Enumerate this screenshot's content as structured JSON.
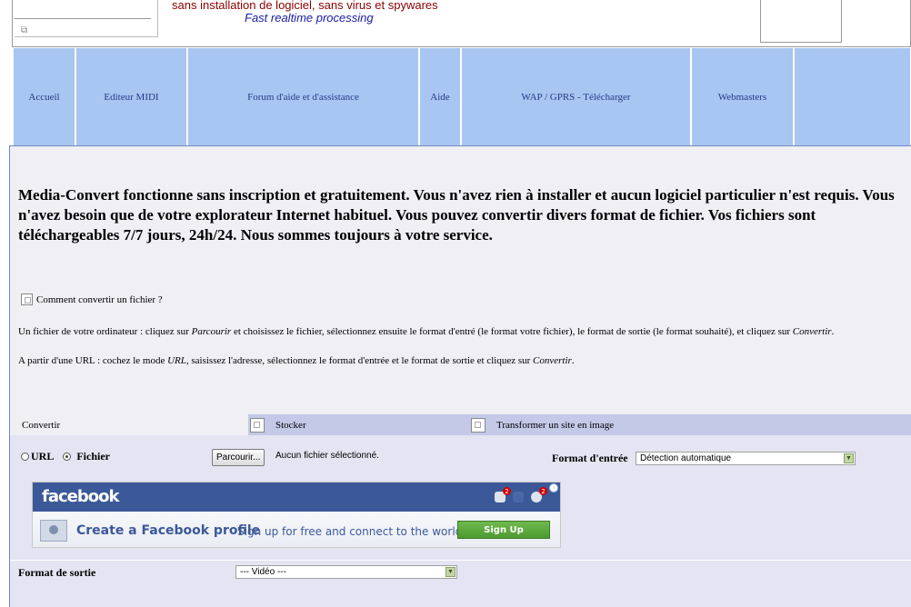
{
  "header": {
    "tagline_main": "sans installation de logiciel, sans virus et spywares",
    "tagline_sub": "Fast realtime processing",
    "left_icon": "broken-image-icon"
  },
  "nav": {
    "items": [
      {
        "label": "Accueil"
      },
      {
        "label": "Editeur MIDI"
      },
      {
        "label": "Forum d'aide et d'assistance"
      },
      {
        "label": "Aide"
      },
      {
        "label": "WAP / GPRS - Télécharger"
      },
      {
        "label": "Webmasters"
      },
      {
        "label": ""
      }
    ],
    "bg_color": "#a7c6f1",
    "text_color": "#263a88"
  },
  "intro": {
    "text": "Media-Convert fonctionne sans inscription et gratuitement. Vous n'avez rien à installer et aucun logiciel particulier n'est requis. Vous n'avez besoin que de votre explorateur Internet habituel. Vous pouvez convertir divers format de fichier. Vos fichiers sont téléchargeables 7/7 jours, 24h/24. Nous sommes toujours à votre service."
  },
  "help": {
    "title": "Comment convertir un fichier ?",
    "line1_a": "Un fichier de votre ordinateur : cliquez sur ",
    "line1_b": "Parcourir",
    "line1_c": " et choisissez le fichier, sélectionnez ensuite le format d'entré (le format votre fichier), le format de sortie (le format souhaité), et cliquez sur ",
    "line1_d": "Convertir",
    "line1_e": ".",
    "line2_a": "A partir d'une URL : cochez le mode ",
    "line2_b": "URL",
    "line2_c": ", saisissez l'adresse, sélectionnez le format d'entrée et le format de sortie et cliquez sur ",
    "line2_d": "Convertir",
    "line2_e": "."
  },
  "tabs": [
    {
      "label": "Convertir",
      "active": true
    },
    {
      "label": "Stocker",
      "active": false
    },
    {
      "label": "Transformer un site en image",
      "active": false
    }
  ],
  "form": {
    "source_url_label": "URL",
    "source_file_label": "Fichier",
    "source_selected": "Fichier",
    "browse_label": "Parcourir...",
    "no_file_text": "Aucun fichier sélectionné.",
    "input_format_label": "Format d'entrée",
    "input_format_value": "Détection automatique",
    "output_format_label": "Format de sortie",
    "output_format_value": "--- Vidéo ---"
  },
  "ad": {
    "brand": "facebook",
    "headline": "Create a Facebook profile",
    "subline": "Sign up for free and connect to the world",
    "button_label": "Sign Up",
    "badges": [
      "2",
      "",
      "2"
    ],
    "info_glyph": "i",
    "brand_color": "#3b5998"
  }
}
